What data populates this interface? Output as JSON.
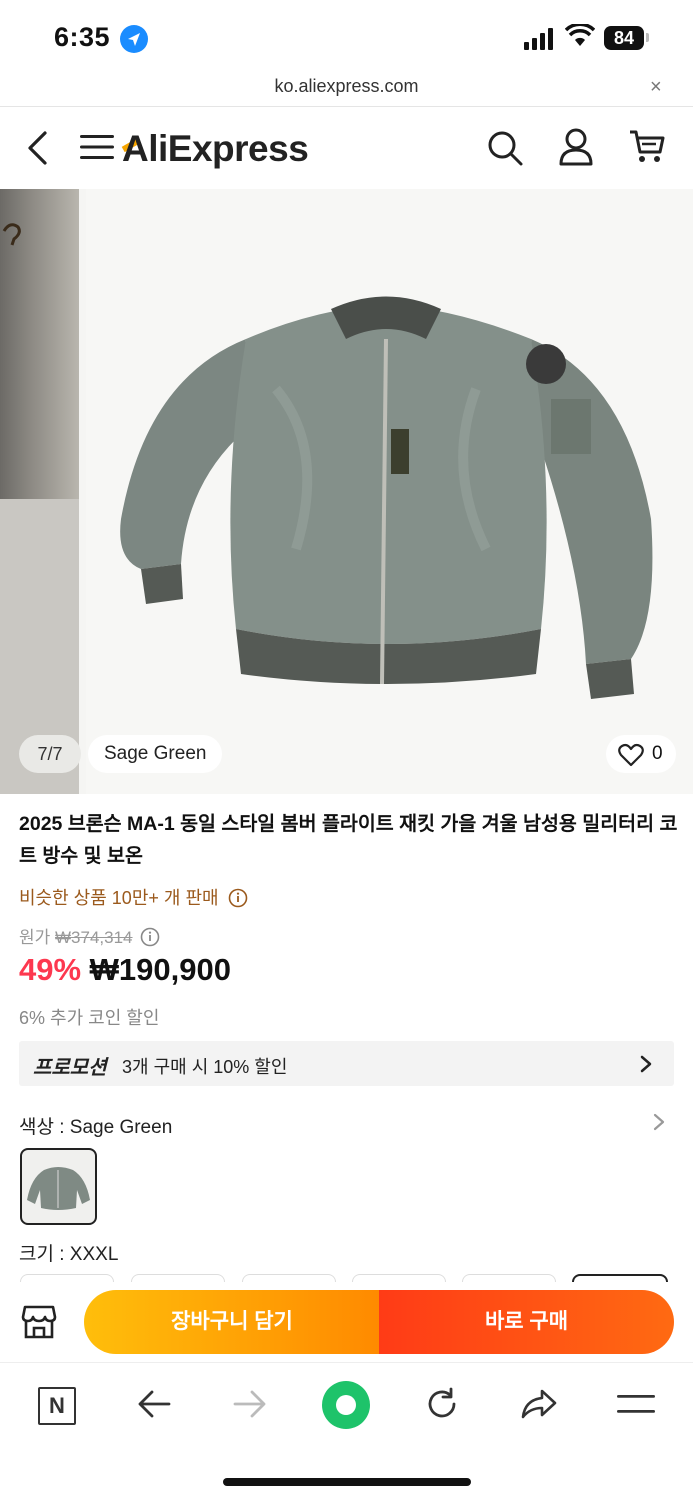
{
  "status_bar": {
    "time": "6:35",
    "battery": "84"
  },
  "browser": {
    "url": "ko.aliexpress.com",
    "close_label": "×"
  },
  "header": {
    "logo_text": "AliExpress",
    "brand_color": "#f7a600"
  },
  "gallery": {
    "counter": "7/7",
    "variant": "Sage Green",
    "likes": "0"
  },
  "product": {
    "title": "2025 브론슨 MA-1 동일 스타일 봄버 플라이트 재킷 가을 겨울 남성용 밀리터리 코트 방수 및 보온",
    "sold": "비슷한 상품 10만+ 개 판매",
    "original_label": "원가",
    "original_price": "₩374,314",
    "discount": "49%",
    "price": "₩190,900",
    "coin_discount": "6% 추가 코인 할인",
    "promo_label": "프로모션",
    "promo_text": "3개 구매 시 10% 할인",
    "color_label": "색상 : Sage Green",
    "size_label": "크기 : XXXL",
    "discount_color": "#fd384f"
  },
  "actions": {
    "add_to_cart": "장바구니 담기",
    "buy_now": "바로 구매"
  },
  "toolbar": {
    "n_label": "N"
  }
}
